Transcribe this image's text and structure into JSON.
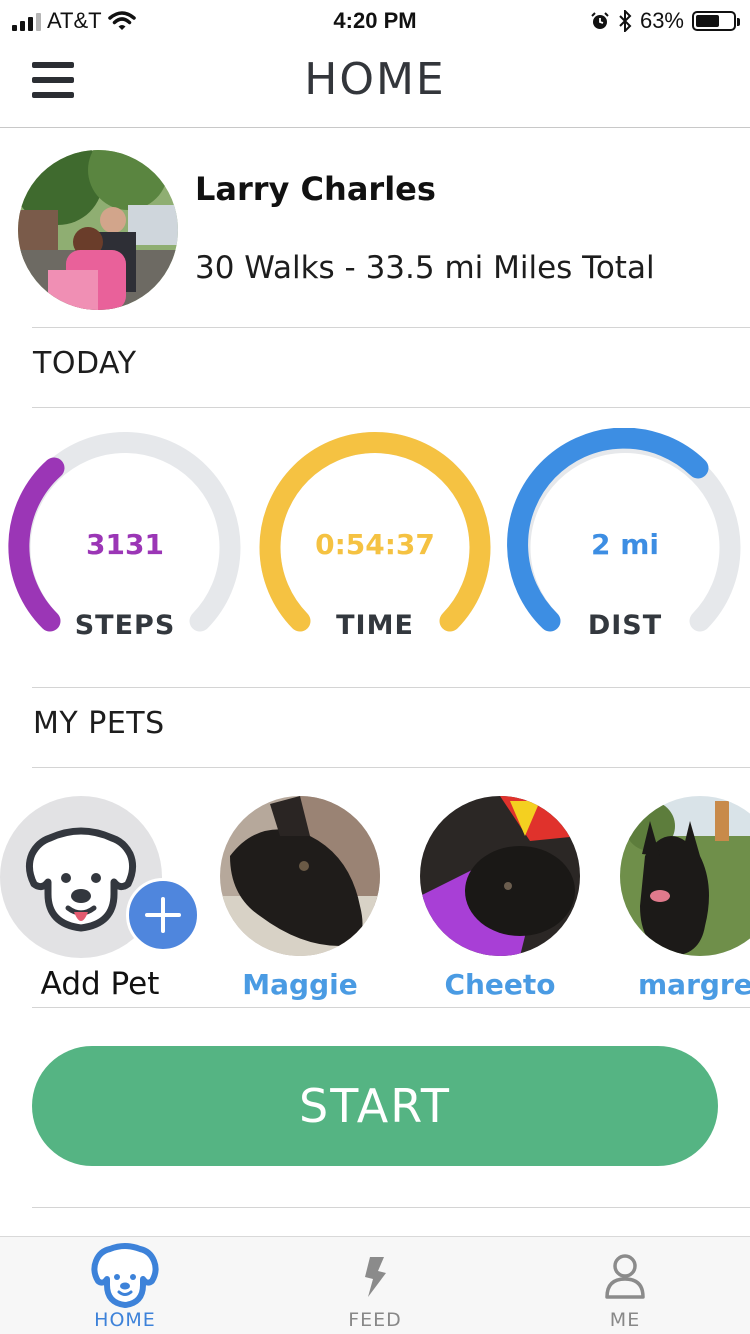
{
  "status_bar": {
    "carrier": "AT&T",
    "time": "4:20 PM",
    "battery": "63%",
    "battery_level": 0.63
  },
  "nav": {
    "title": "HOME"
  },
  "profile": {
    "name": "Larry Charles",
    "stats": "30 Walks - 33.5 mi Miles Total"
  },
  "today": {
    "label": "TODAY",
    "gauges": [
      {
        "value": "3131",
        "label": "STEPS",
        "color": "#9b36b6"
      },
      {
        "value": "0:54:37",
        "label": "TIME",
        "color": "#f5c242"
      },
      {
        "value": "2 mi",
        "label": "DIST",
        "color": "#3d8ee3"
      }
    ],
    "track_color": "#e6e8eb"
  },
  "pets": {
    "label": "MY PETS",
    "add_label": "Add Pet",
    "items": [
      {
        "name": "Maggie"
      },
      {
        "name": "Cheeto"
      },
      {
        "name": "margre"
      }
    ]
  },
  "start": {
    "label": "START",
    "color": "#55b483"
  },
  "tabs": [
    {
      "label": "HOME",
      "icon": "dog-face-icon",
      "active": true
    },
    {
      "label": "FEED",
      "icon": "lightning-icon",
      "active": false
    },
    {
      "label": "ME",
      "icon": "person-icon",
      "active": false
    }
  ]
}
